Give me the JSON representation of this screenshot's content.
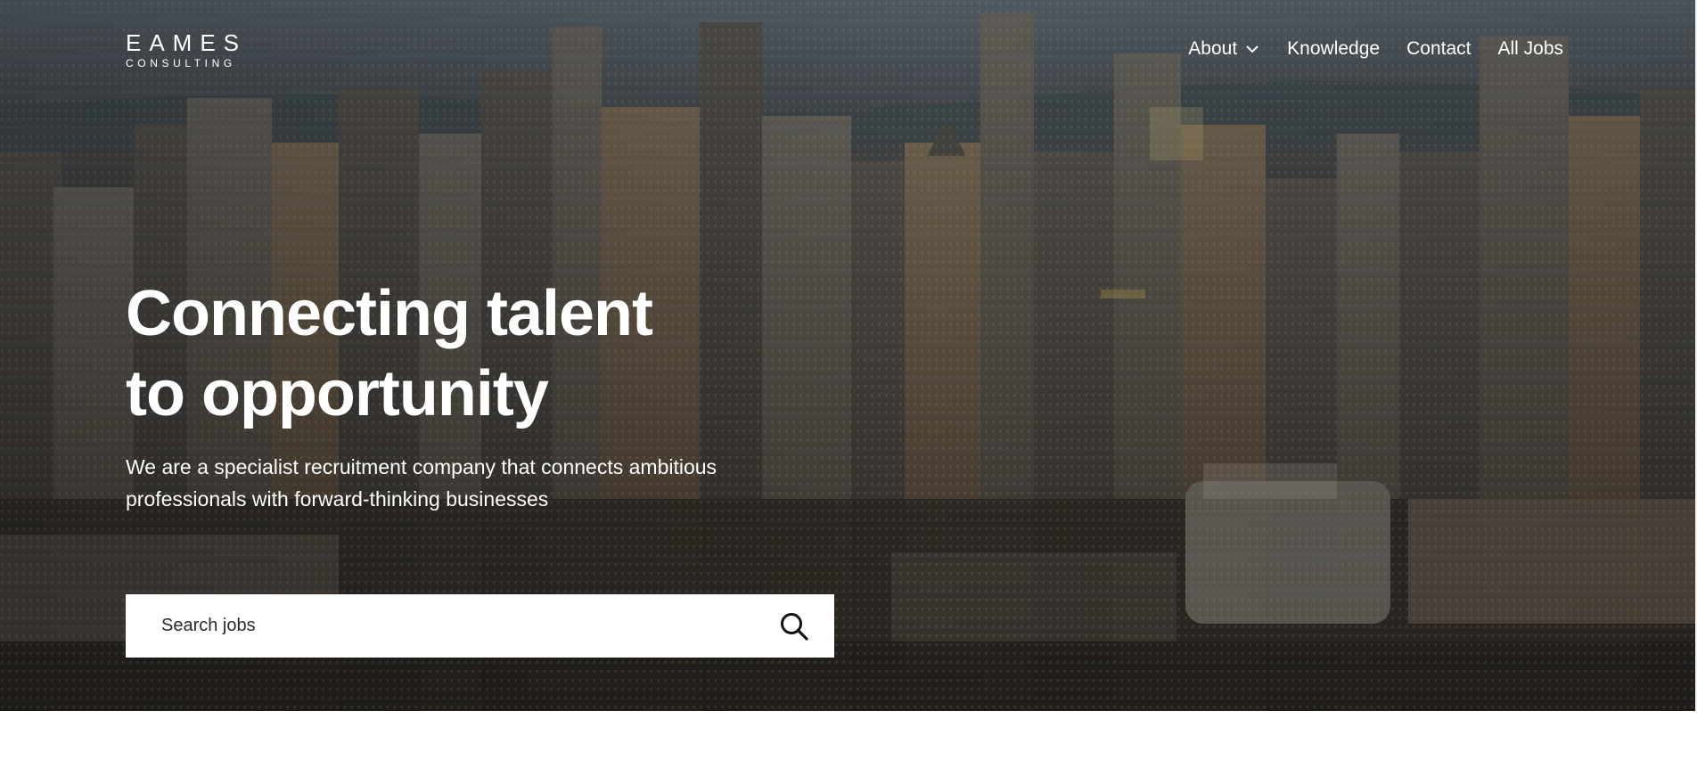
{
  "brand": {
    "logo_main": "EAMES",
    "logo_sub": "CONSULTING"
  },
  "nav": {
    "items": [
      {
        "label": "About",
        "has_dropdown": true
      },
      {
        "label": "Knowledge"
      },
      {
        "label": "Contact"
      },
      {
        "label": "All Jobs"
      }
    ]
  },
  "hero": {
    "headline_line1": "Connecting talent",
    "headline_line2": "to opportunity",
    "subtitle": "We are a specialist recruitment company that connects ambitious professionals with forward-thinking businesses",
    "background": "city-skyline-photo"
  },
  "search": {
    "placeholder": "Search jobs",
    "value": "",
    "icon": "search-icon"
  },
  "colors": {
    "text_on_hero": "#ffffff",
    "search_bg": "#ffffff",
    "page_bg": "#ffffff"
  }
}
